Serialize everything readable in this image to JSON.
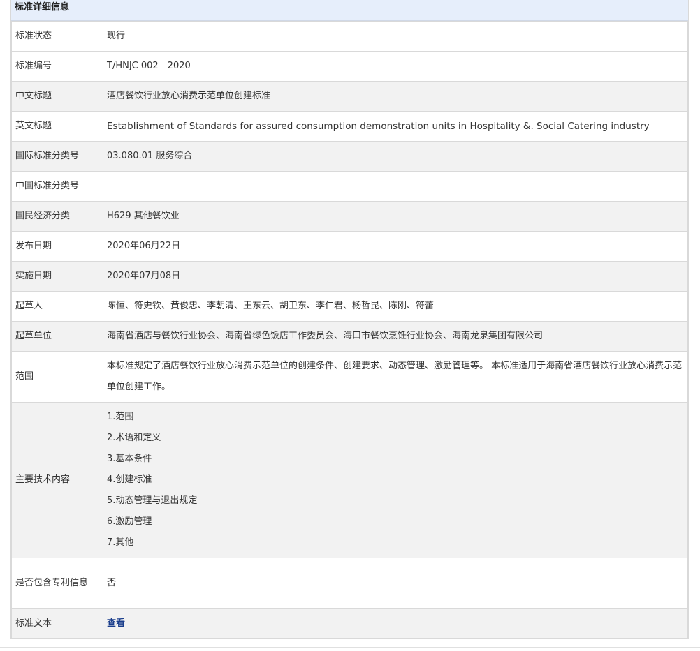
{
  "header": {
    "title": "标准详细信息"
  },
  "rows": {
    "status": {
      "label": "标准状态",
      "value": "现行"
    },
    "number": {
      "label": "标准编号",
      "value": "T/HNJC 002—2020"
    },
    "cn_title": {
      "label": "中文标题",
      "value": "酒店餐饮行业放心消费示范单位创建标准"
    },
    "en_title": {
      "label": "英文标题",
      "value": "Establishment of Standards for assured consumption demonstration units in Hospitality &. Social Catering industry"
    },
    "ics": {
      "label": "国际标准分类号",
      "value": "03.080.01 服务综合"
    },
    "ccs": {
      "label": "中国标准分类号",
      "value": ""
    },
    "economy": {
      "label": "国民经济分类",
      "value": "H629 其他餐饮业"
    },
    "publish_date": {
      "label": "发布日期",
      "value": "2020年06月22日"
    },
    "effective_date": {
      "label": "实施日期",
      "value": "2020年07月08日"
    },
    "drafters": {
      "label": "起草人",
      "value": "陈恒、符史钦、黄俊忠、李朝清、王东云、胡卫东、李仁君、杨哲昆、陈刚、符蕾"
    },
    "drafting_units": {
      "label": "起草单位",
      "value": "海南省酒店与餐饮行业协会、海南省绿色饭店工作委员会、海口市餐饮烹饪行业协会、海南龙泉集团有限公司"
    },
    "scope": {
      "label": "范围",
      "value": "本标准规定了酒店餐饮行业放心消费示范单位的创建条件、创建要求、动态管理、激励管理等。 本标准适用于海南省酒店餐饮行业放心消费示范单位创建工作。"
    },
    "content": {
      "label": "主要技术内容",
      "items": [
        "1.范围",
        "2.术语和定义",
        "3.基本条件",
        "4.创建标准",
        "5.动态管理与退出规定",
        "6.激励管理",
        "7.其他"
      ]
    },
    "patent": {
      "label": "是否包含专利信息",
      "value": "否"
    },
    "text": {
      "label": "标准文本",
      "link": "查看"
    }
  }
}
